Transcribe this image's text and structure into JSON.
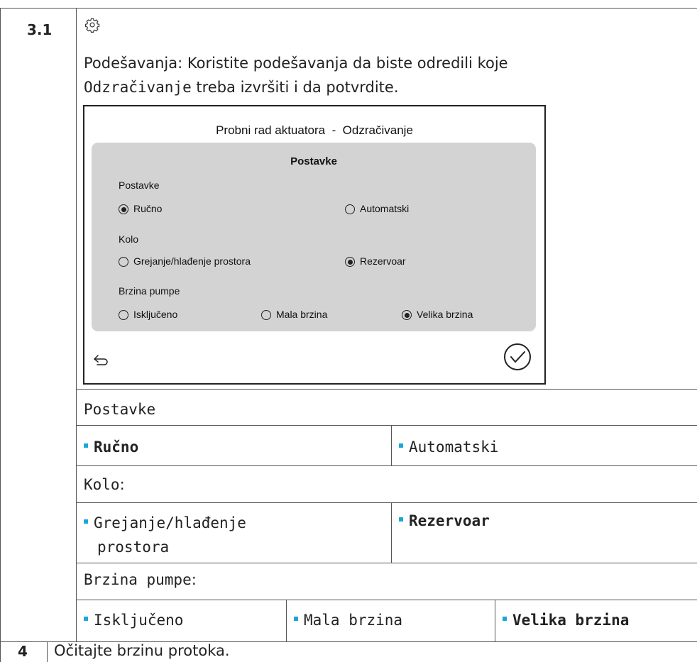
{
  "step_3_1": {
    "number": "3.1",
    "icon": "gear-icon",
    "description_prefix": "Podešavanja: Koristite podešavanja da biste odredili koje",
    "description_code": "Odzračivanje",
    "description_suffix": " treba izvršiti i da potvrdite."
  },
  "screen": {
    "title": "Probni rad aktuatora  -  Odzračivanje",
    "panel_title": "Postavke",
    "group1": {
      "label": "Postavke",
      "options": [
        {
          "label": "Ručno",
          "selected": true
        },
        {
          "label": "Automatski",
          "selected": false
        }
      ]
    },
    "group2": {
      "label": "Kolo",
      "options": [
        {
          "label": "Grejanje/hlađenje prostora",
          "selected": false
        },
        {
          "label": "Rezervoar",
          "selected": true
        }
      ]
    },
    "group3": {
      "label": "Brzina pumpe",
      "options": [
        {
          "label": "Isključeno",
          "selected": false
        },
        {
          "label": "Mala brzina",
          "selected": false
        },
        {
          "label": "Velika brzina",
          "selected": true
        }
      ]
    },
    "back_icon": "back-arrow-icon",
    "confirm_icon": "checkmark-circle-icon"
  },
  "table": {
    "row1_header": "Postavke",
    "row1_opts": [
      "Ručno",
      "Automatski"
    ],
    "row2_header_main": "Kolo",
    "row2_header_colon": ":",
    "row2_opt1_line1": "Grejanje/hlađenje",
    "row2_opt1_line2": "prostora",
    "row2_opt2": "Rezervoar",
    "row3_header_main": "Brzina pumpe",
    "row3_header_colon": ":",
    "row3_opts": [
      "Isključeno",
      "Mala brzina",
      "Velika brzina"
    ]
  },
  "step_4": {
    "number": "4",
    "text": "Očitajte brzinu protoka."
  },
  "colors": {
    "bullet": "#19a7d8",
    "panel_bg": "#d3d3d3",
    "rule": "#555555"
  }
}
